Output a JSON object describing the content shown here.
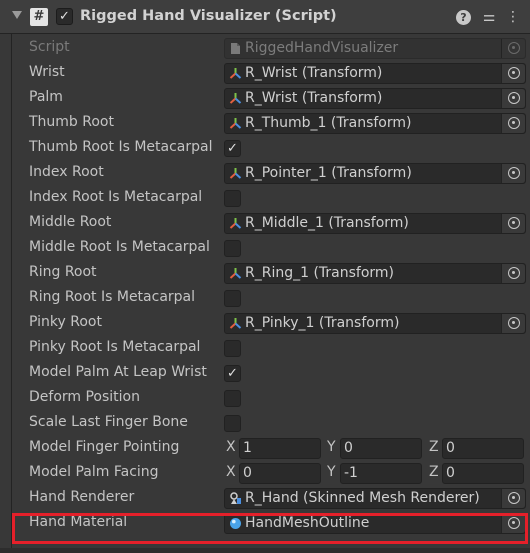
{
  "component": {
    "title": "Rigged Hand Visualizer (Script)",
    "enabled": true,
    "header_icons": [
      "help-icon",
      "presets-icon",
      "context-menu-icon"
    ]
  },
  "fields": [
    {
      "label": "Script",
      "kind": "object",
      "value": "RiggedHandVisualizer",
      "icon": "script-file-icon",
      "disabled": true
    },
    {
      "label": "Wrist",
      "kind": "object",
      "value": "R_Wrist (Transform)",
      "icon": "transform-icon"
    },
    {
      "label": "Palm",
      "kind": "object",
      "value": "R_Wrist (Transform)",
      "icon": "transform-icon"
    },
    {
      "label": "Thumb Root",
      "kind": "object",
      "value": "R_Thumb_1 (Transform)",
      "icon": "transform-icon"
    },
    {
      "label": "Thumb Root Is Metacarpal",
      "kind": "bool",
      "checked": true
    },
    {
      "label": "Index Root",
      "kind": "object",
      "value": "R_Pointer_1 (Transform)",
      "icon": "transform-icon"
    },
    {
      "label": "Index Root Is Metacarpal",
      "kind": "bool",
      "checked": false
    },
    {
      "label": "Middle Root",
      "kind": "object",
      "value": "R_Middle_1 (Transform)",
      "icon": "transform-icon"
    },
    {
      "label": "Middle Root Is Metacarpal",
      "kind": "bool",
      "checked": false
    },
    {
      "label": "Ring Root",
      "kind": "object",
      "value": "R_Ring_1 (Transform)",
      "icon": "transform-icon"
    },
    {
      "label": "Ring Root Is Metacarpal",
      "kind": "bool",
      "checked": false
    },
    {
      "label": "Pinky Root",
      "kind": "object",
      "value": "R_Pinky_1 (Transform)",
      "icon": "transform-icon"
    },
    {
      "label": "Pinky Root Is Metacarpal",
      "kind": "bool",
      "checked": false
    },
    {
      "label": "Model Palm At Leap Wrist",
      "kind": "bool",
      "checked": true
    },
    {
      "label": "Deform Position",
      "kind": "bool",
      "checked": false
    },
    {
      "label": "Scale Last Finger Bone",
      "kind": "bool",
      "checked": false
    },
    {
      "label": "Model Finger Pointing",
      "kind": "vector3",
      "x": "1",
      "y": "0",
      "z": "0"
    },
    {
      "label": "Model Palm Facing",
      "kind": "vector3",
      "x": "0",
      "y": "-1",
      "z": "0"
    },
    {
      "label": "Hand Renderer",
      "kind": "object",
      "value": "R_Hand (Skinned Mesh Renderer)",
      "icon": "skinned-mesh-renderer-icon"
    },
    {
      "label": "Hand Material",
      "kind": "object",
      "value": "HandMeshOutline",
      "icon": "material-sphere-icon"
    }
  ],
  "vector_axes": [
    "X",
    "Y",
    "Z"
  ],
  "checkmark": "✓",
  "colors": {
    "highlight": "#e5202a",
    "transform_icon": [
      "#e06040",
      "#7ec24a",
      "#4a8fe0"
    ],
    "material_icon": "#4aa3e8"
  }
}
